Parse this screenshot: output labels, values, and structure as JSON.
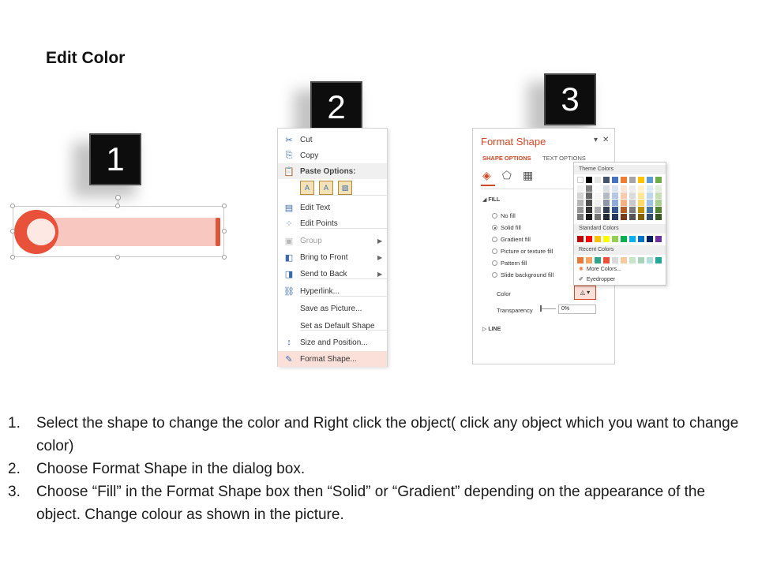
{
  "page": {
    "title": "Edit Color"
  },
  "badges": [
    "1",
    "2",
    "3"
  ],
  "context_menu": {
    "items": [
      {
        "label": "Cut",
        "icon": "scissors-icon",
        "glyph": "✂",
        "state": "normal"
      },
      {
        "label": "Copy",
        "icon": "copy-icon",
        "glyph": "⎘",
        "state": "normal"
      },
      {
        "label": "Paste Options:",
        "icon": "paste-icon",
        "glyph": "📋",
        "state": "header"
      },
      {
        "label": "Edit Text",
        "icon": "edit-text-icon",
        "glyph": "▤",
        "state": "normal"
      },
      {
        "label": "Edit Points",
        "icon": "edit-points-icon",
        "glyph": "⁘",
        "state": "normal"
      },
      {
        "label": "Group",
        "icon": "group-icon",
        "glyph": "▣",
        "state": "disabled",
        "submenu": true
      },
      {
        "label": "Bring to Front",
        "icon": "bring-front-icon",
        "glyph": "◧",
        "state": "normal",
        "submenu": true
      },
      {
        "label": "Send to Back",
        "icon": "send-back-icon",
        "glyph": "◨",
        "state": "normal",
        "submenu": true
      },
      {
        "label": "Hyperlink...",
        "icon": "hyperlink-icon",
        "glyph": "⛓",
        "state": "normal"
      },
      {
        "label": "Save as Picture...",
        "icon": "",
        "glyph": "",
        "state": "normal"
      },
      {
        "label": "Set as Default Shape",
        "icon": "",
        "glyph": "",
        "state": "normal"
      },
      {
        "label": "Size and Position...",
        "icon": "size-position-icon",
        "glyph": "↕",
        "state": "normal"
      },
      {
        "label": "Format Shape...",
        "icon": "format-shape-icon",
        "glyph": "✎",
        "state": "highlighted"
      }
    ]
  },
  "format_pane": {
    "title": "Format Shape",
    "tabs": [
      "SHAPE OPTIONS",
      "TEXT OPTIONS"
    ],
    "sections": {
      "fill": "FILL",
      "line": "LINE"
    },
    "fill_options": [
      {
        "label": "No fill",
        "selected": false
      },
      {
        "label": "Solid fill",
        "selected": true
      },
      {
        "label": "Gradient fill",
        "selected": false
      },
      {
        "label": "Picture or texture fill",
        "selected": false
      },
      {
        "label": "Pattern fill",
        "selected": false
      },
      {
        "label": "Slide background fill",
        "selected": false
      }
    ],
    "color_label": "Color",
    "transparency_label": "Transparency",
    "transparency_value": "0%",
    "accent": "#d24726"
  },
  "color_palette": {
    "theme_header": "Theme Colors",
    "standard_header": "Standard Colors",
    "recent_header": "Recent Colors",
    "more_colors": "More Colors...",
    "eyedropper": "Eyedropper",
    "theme_top": [
      "#ffffff",
      "#000000",
      "#e7e6e6",
      "#44546a",
      "#4472c4",
      "#ed7d31",
      "#a5a5a5",
      "#ffc000",
      "#5b9bd5",
      "#70ad47"
    ],
    "standard": [
      "#c00000",
      "#ff0000",
      "#ffc000",
      "#ffff00",
      "#92d050",
      "#00b050",
      "#00b0f0",
      "#0070c0",
      "#002060",
      "#7030a0"
    ],
    "recent": [
      "#e8793b",
      "#f4a460",
      "#2ea58a",
      "#e8513a",
      "#d9d9d9",
      "#f6c9a0",
      "#c8e6c9",
      "#a8d5ba",
      "#b2dfdb",
      "#26a69a"
    ]
  },
  "instructions": [
    {
      "num": "1.",
      "text": "Select the shape to change the color and Right click the object( click any object which you want to change color)"
    },
    {
      "num": "2.",
      "text": "Choose Format Shape in the dialog box."
    },
    {
      "num": "3.",
      "text": "Choose “Fill” in the Format Shape box then “Solid” or “Gradient” depending on the appearance of the object. Change colour as shown in the picture."
    }
  ]
}
